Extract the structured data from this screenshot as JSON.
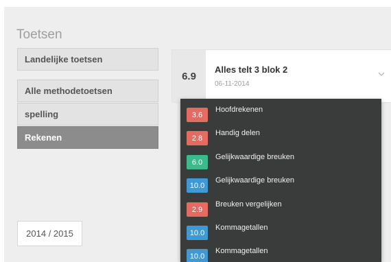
{
  "page": {
    "title": "Toetsen"
  },
  "sidebar": {
    "items": [
      {
        "label": "Landelijke toetsen"
      },
      {
        "label": "Alle methodetoetsen"
      },
      {
        "label": "spelling"
      },
      {
        "label": "Rekenen"
      }
    ],
    "active_item": "Rekenen"
  },
  "year_selector": {
    "value": "2014 / 2015"
  },
  "test_card": {
    "grade": "6.9",
    "name": "Alles telt 3 blok 2",
    "date": "06-11-2014",
    "chevron_icon": "chevron-down-icon"
  },
  "dropdown": {
    "items": [
      {
        "grade": "3.6",
        "label": "Hoofdrekenen",
        "color": "#e46a62"
      },
      {
        "grade": "2.8",
        "label": "Handig delen",
        "color": "#e46a62"
      },
      {
        "grade": "6.0",
        "label": "Gelijkwaardige breuken",
        "color": "#3cb98d"
      },
      {
        "grade": "10.0",
        "label": "Gelijkwaardige breuken",
        "color": "#3f9ad4"
      },
      {
        "grade": "2.9",
        "label": "Breuken vergelijken",
        "color": "#e46a62"
      },
      {
        "grade": "10.0",
        "label": "Kommagetallen",
        "color": "#3f9ad4"
      },
      {
        "grade": "10.0",
        "label": "Kommagetallen",
        "color": "#3f9ad4"
      }
    ]
  },
  "colors": {
    "insufficient": "#e46a62",
    "sufficient": "#3cb98d",
    "excellent": "#3f9ad4",
    "active_nav": "#8c8c8c",
    "dropdown_bg": "#3a3b3b"
  }
}
